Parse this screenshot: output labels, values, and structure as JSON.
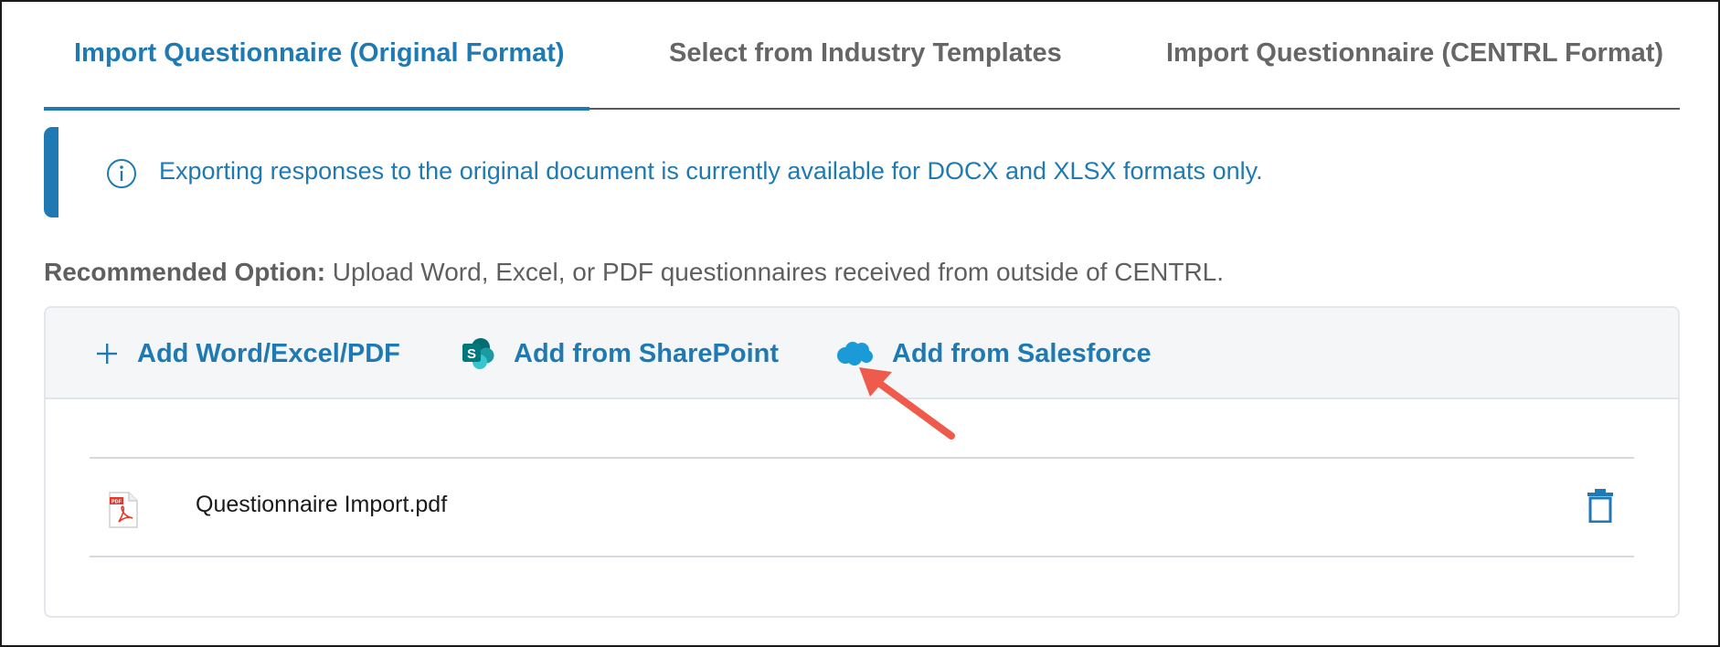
{
  "tabs": [
    {
      "label": "Import Questionnaire (Original Format)",
      "active": true
    },
    {
      "label": "Select from Industry Templates",
      "active": false
    },
    {
      "label": "Import Questionnaire (CENTRL Format)",
      "active": false
    }
  ],
  "info_banner": {
    "icon": "info-icon",
    "text": "Exporting responses to the original document is currently available for DOCX and XLSX formats only."
  },
  "recommended": {
    "label": "Recommended Option:",
    "text": " Upload Word, Excel, or PDF questionnaires received from outside of CENTRL."
  },
  "toolbar": {
    "add_file": {
      "label": "Add Word/Excel/PDF",
      "icon": "plus-icon"
    },
    "sharepoint": {
      "label": "Add from SharePoint",
      "icon": "sharepoint-icon"
    },
    "salesforce": {
      "label": "Add from Salesforce",
      "icon": "salesforce-cloud-icon"
    }
  },
  "files": [
    {
      "name": "Questionnaire Import.pdf",
      "icon": "pdf-file-icon",
      "action_icon": "trash-icon"
    }
  ],
  "colors": {
    "accent": "#1f7ab3",
    "annotation_arrow": "#ee5a4c",
    "salesforce": "#1a9ad6",
    "sharepoint": "#0b7a75"
  }
}
